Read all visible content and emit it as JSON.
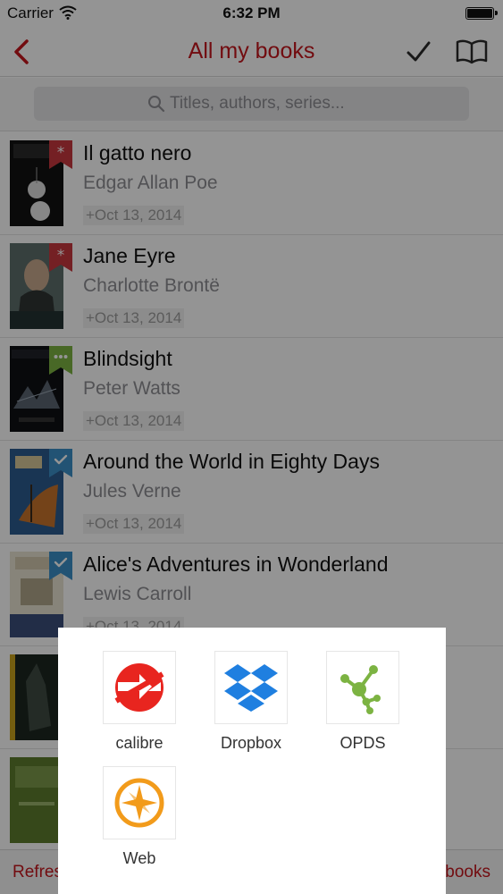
{
  "status_bar": {
    "carrier": "Carrier",
    "time": "6:32 PM"
  },
  "nav": {
    "title": "All my books",
    "back_icon": "chevron-left-icon",
    "select_icon": "checkmark-icon",
    "read_icon": "open-book-icon",
    "accent_color": "#c4151c"
  },
  "search": {
    "placeholder": "Titles, authors, series..."
  },
  "books": [
    {
      "title": "Il gatto nero",
      "author": "Edgar Allan Poe",
      "date": "+Oct 13, 2014",
      "badge": "new-star-badge"
    },
    {
      "title": "Jane Eyre",
      "author": "Charlotte Brontë",
      "date": "+Oct 13, 2014",
      "badge": "new-star-badge"
    },
    {
      "title": "Blindsight",
      "author": "Peter Watts",
      "date": "+Oct 13, 2014",
      "badge": "reading-dots-badge"
    },
    {
      "title": "Around the World in Eighty Days",
      "author": "Jules Verne",
      "date": "+Oct 13, 2014",
      "badge": "finished-check-badge"
    },
    {
      "title": "Alice's Adventures in Wonderland",
      "author": "Lewis Carroll",
      "date": "+Oct 13, 2014",
      "badge": "finished-check-badge"
    }
  ],
  "toolbar": {
    "left_label": "Refres",
    "right_label": "books"
  },
  "sources": [
    {
      "label": "calibre",
      "icon": "calibre-icon"
    },
    {
      "label": "Dropbox",
      "icon": "dropbox-icon"
    },
    {
      "label": "OPDS",
      "icon": "opds-icon"
    },
    {
      "label": "Web",
      "icon": "compass-icon"
    }
  ]
}
